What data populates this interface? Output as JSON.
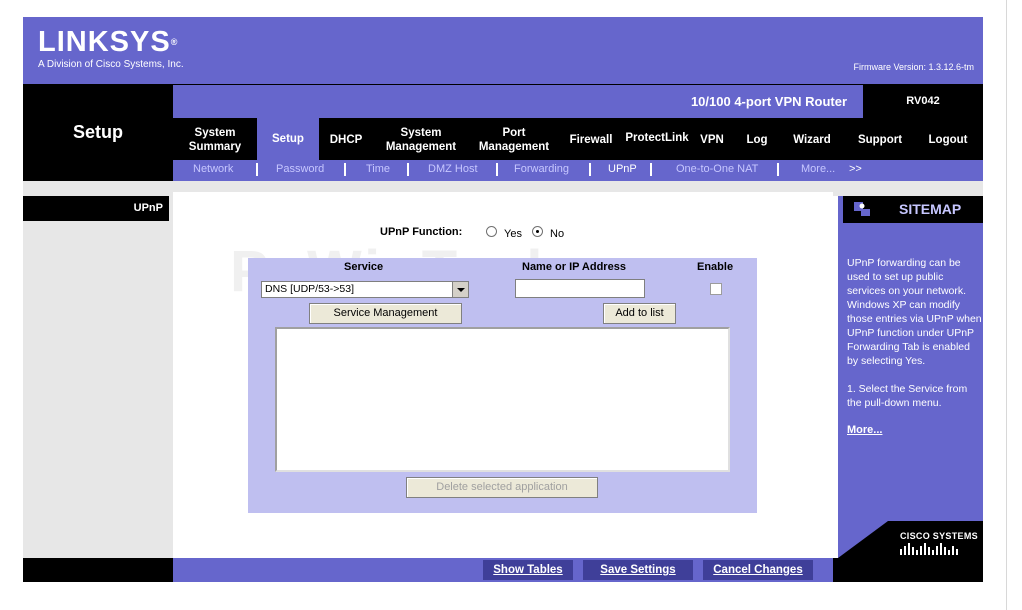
{
  "header": {
    "brand": "LINKSYS",
    "brand_mark": "®",
    "subtitle": "A Division of Cisco Systems, Inc.",
    "firmware": "Firmware Version: 1.3.12.6-tm"
  },
  "page_title": "Setup",
  "product": {
    "name": "10/100 4-port VPN Router",
    "model": "RV042"
  },
  "nav": {
    "items": [
      {
        "label": "System\nSummary"
      },
      {
        "label": "Setup"
      },
      {
        "label": "DHCP"
      },
      {
        "label": "System\nManagement"
      },
      {
        "label": "Port\nManagement"
      },
      {
        "label": "Firewall"
      },
      {
        "label": "ProtectLink"
      },
      {
        "label": "VPN"
      },
      {
        "label": "Log"
      },
      {
        "label": "Wizard"
      },
      {
        "label": "Support"
      },
      {
        "label": "Logout"
      }
    ],
    "active": "Setup"
  },
  "subnav": {
    "items": [
      "Network",
      "Password",
      "Time",
      "DMZ Host",
      "Forwarding",
      "UPnP",
      "One-to-One NAT",
      "More...",
      ">>"
    ],
    "active": "UPnP"
  },
  "left_label": "UPnP",
  "watermark": "PcWinTech.com",
  "form": {
    "function_label": "UPnP Function:",
    "yes_label": "Yes",
    "no_label": "No",
    "selected": "No",
    "col_service": "Service",
    "col_name_ip": "Name or IP Address",
    "col_enable": "Enable",
    "service_value": "DNS [UDP/53->53]",
    "ip_value": "",
    "enable_checked": false,
    "service_mgmt_button": "Service Management",
    "add_button": "Add to list",
    "delete_button": "Delete selected application",
    "list_items": []
  },
  "help": {
    "title": "SITEMAP",
    "text": "UPnP forwarding can be used to set up public services on your network. Windows XP can modify those entries via UPnP when UPnP function under UPnP Forwarding Tab is enabled by selecting Yes.",
    "step": "1. Select the Service from the pull-down menu.",
    "more": "More..."
  },
  "cisco": "CISCO SYSTEMS",
  "footer": {
    "show_tables": "Show Tables",
    "save_settings": "Save Settings",
    "cancel_changes": "Cancel Changes"
  },
  "colors": {
    "brand_purple": "#6666cc",
    "panel_lavender": "#bfbff0",
    "dark": "#000000"
  }
}
